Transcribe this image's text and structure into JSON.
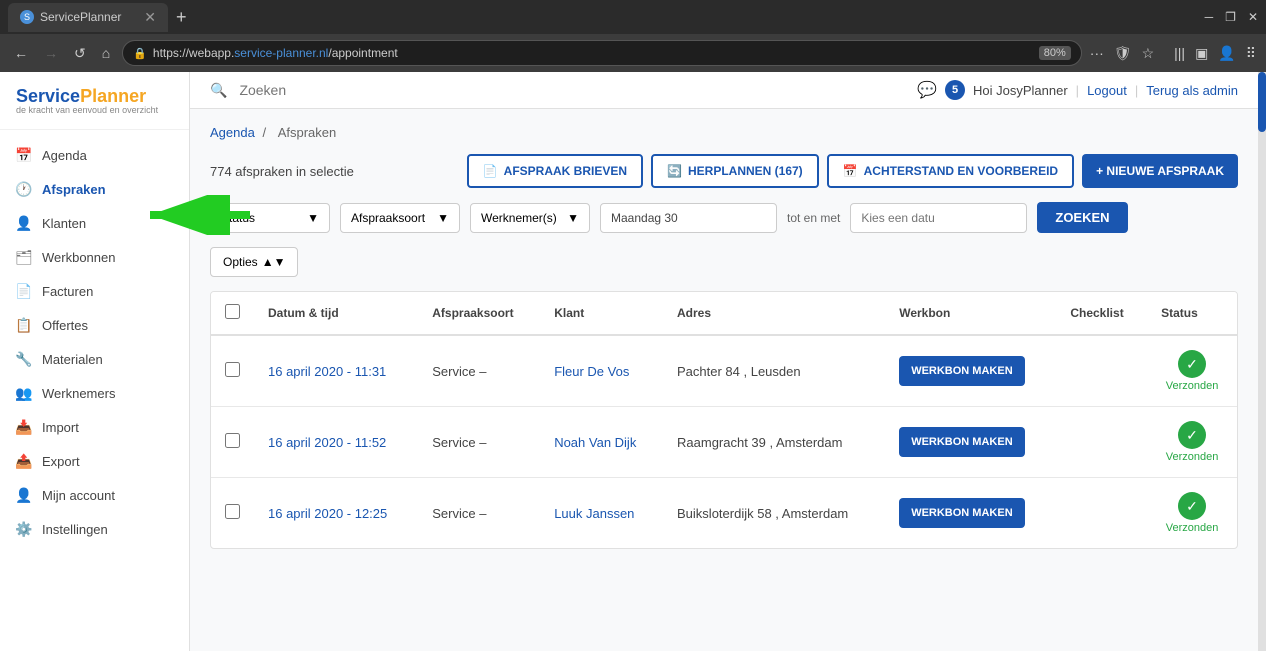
{
  "browser": {
    "tab_title": "ServicePlanner",
    "url_prefix": "https://webapp.",
    "url_domain": "service-planner.nl",
    "url_path": "/appointment",
    "zoom": "80%",
    "new_tab_label": "+",
    "back_disabled": false,
    "forward_disabled": true
  },
  "header": {
    "search_placeholder": "Zoeken",
    "message_count": "5",
    "greeting": "Hoi JosyPlanner",
    "logout_label": "Logout",
    "admin_label": "Terug als admin"
  },
  "sidebar": {
    "logo_service": "Service",
    "logo_planner": "Planner",
    "logo_sub": "de kracht van eenvoud en overzicht",
    "items": [
      {
        "id": "agenda",
        "label": "Agenda",
        "icon": "📅"
      },
      {
        "id": "afspraken",
        "label": "Afspraken",
        "icon": "🕐",
        "active": true
      },
      {
        "id": "klanten",
        "label": "Klanten",
        "icon": "👤"
      },
      {
        "id": "werkbonnen",
        "label": "Werkbonnen",
        "icon": "🗂"
      },
      {
        "id": "facturen",
        "label": "Facturen",
        "icon": "📄"
      },
      {
        "id": "offertes",
        "label": "Offertes",
        "icon": "📋"
      },
      {
        "id": "materialen",
        "label": "Materialen",
        "icon": "🔧"
      },
      {
        "id": "werknemers",
        "label": "Werknemers",
        "icon": "👥"
      },
      {
        "id": "import",
        "label": "Import",
        "icon": "📥"
      },
      {
        "id": "export",
        "label": "Export",
        "icon": "📤"
      },
      {
        "id": "mijn-account",
        "label": "Mijn account",
        "icon": "👤"
      },
      {
        "id": "instellingen",
        "label": "Instellingen",
        "icon": "⚙️"
      }
    ]
  },
  "breadcrumb": {
    "parent": "Agenda",
    "current": "Afspraken"
  },
  "content": {
    "selection_count": "774 afspraken in selectie",
    "btn_brieven": "AFSPRAAK BRIEVEN",
    "btn_herplannen": "HERPLANNEN (167)",
    "btn_achterstand": "ACHTERSTAND EN VOORBEREID",
    "btn_nieuwe": "+ NIEUWE AFSPRAAK",
    "filter_status": "Status",
    "filter_afspraaksoort": "Afspraaksoort",
    "filter_werknemer": "Werknemer(s)",
    "filter_date": "Maandag 30",
    "filter_tot_en_met": "tot en met",
    "filter_date2_placeholder": "Kies een datu",
    "btn_zoeken": "ZOEKEN",
    "btn_opties": "Opties",
    "table_headers": {
      "col1": "",
      "col2": "Datum & tijd",
      "col3": "Afspraaksoort",
      "col4": "Klant",
      "col5": "Adres",
      "col6": "Werkbon",
      "col7": "Checklist",
      "col8": "Status"
    },
    "rows": [
      {
        "date": "16 april 2020 - 11:31",
        "afspraaksoort": "Service –",
        "klant": "Fleur De Vos",
        "adres": "Pachter 84 , Leusden",
        "werkbon_label": "WERKBON MAKEN",
        "status": "Verzonden"
      },
      {
        "date": "16 april 2020 - 11:52",
        "afspraaksoort": "Service –",
        "klant": "Noah Van Dijk",
        "adres": "Raamgracht 39 , Amsterdam",
        "werkbon_label": "WERKBON MAKEN",
        "status": "Verzonden"
      },
      {
        "date": "16 april 2020 - 12:25",
        "afspraaksoort": "Service –",
        "klant": "Luuk Janssen",
        "adres": "Buiksloterdijk 58 , Amsterdam",
        "werkbon_label": "WERKBON MAKEN",
        "status": "Verzonden"
      }
    ]
  }
}
